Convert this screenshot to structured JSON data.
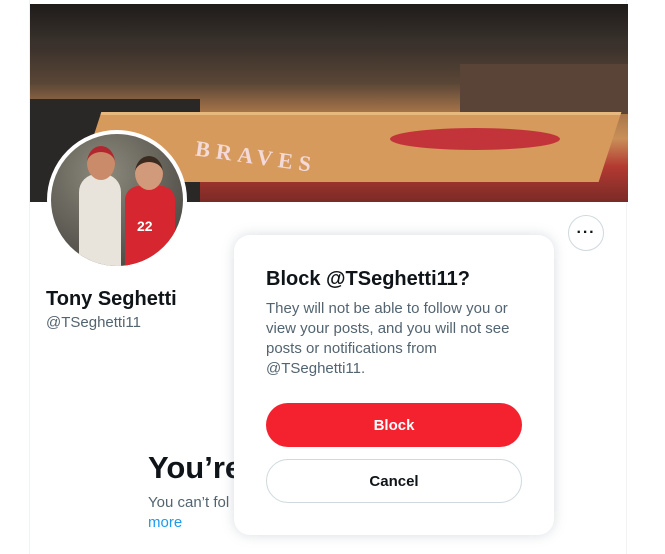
{
  "profile": {
    "display_name": "Tony Seghetti",
    "handle": "@TSeghetti11",
    "banner_text": "BRAVES",
    "avatar_jersey_text": "22",
    "more_options_icon": "···"
  },
  "blocked_notice": {
    "title": "You’re",
    "text": "You can’t fol",
    "more_link": "more"
  },
  "dialog": {
    "title": "Block @TSeghetti11?",
    "body": "They will not be able to follow you or view your posts, and you will not see posts or notifications from @TSeghetti11.",
    "block_label": "Block",
    "cancel_label": "Cancel"
  },
  "colors": {
    "block_red": "#f4212e",
    "link_blue": "#1d9bf0",
    "text_primary": "#0f1419",
    "text_secondary": "#536471"
  }
}
